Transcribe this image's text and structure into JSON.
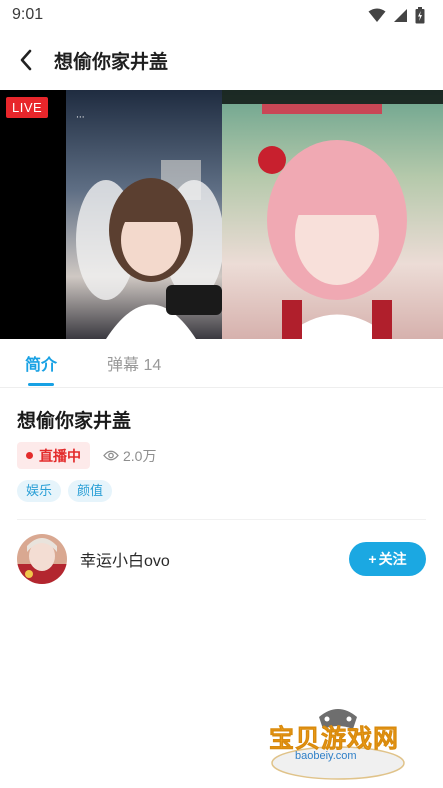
{
  "status_bar": {
    "time": "9:01"
  },
  "header": {
    "title": "想偷你家井盖"
  },
  "player": {
    "live_label": "LIVE"
  },
  "tabs": [
    {
      "label": "简介"
    },
    {
      "label": "弹幕 14"
    }
  ],
  "stream": {
    "title": "想偷你家井盖",
    "status_label": "直播中",
    "views": "2.0万",
    "tags": [
      "娱乐",
      "颜值"
    ]
  },
  "anchor": {
    "name": "幸运小白ovo",
    "follow_label": "关注"
  },
  "watermark": {
    "name": "宝贝游戏网",
    "url": "baobeiy.com"
  },
  "colors": {
    "accent": "#18a1e4",
    "live_red": "#e8262b",
    "tag_text": "#2a9fd6"
  }
}
